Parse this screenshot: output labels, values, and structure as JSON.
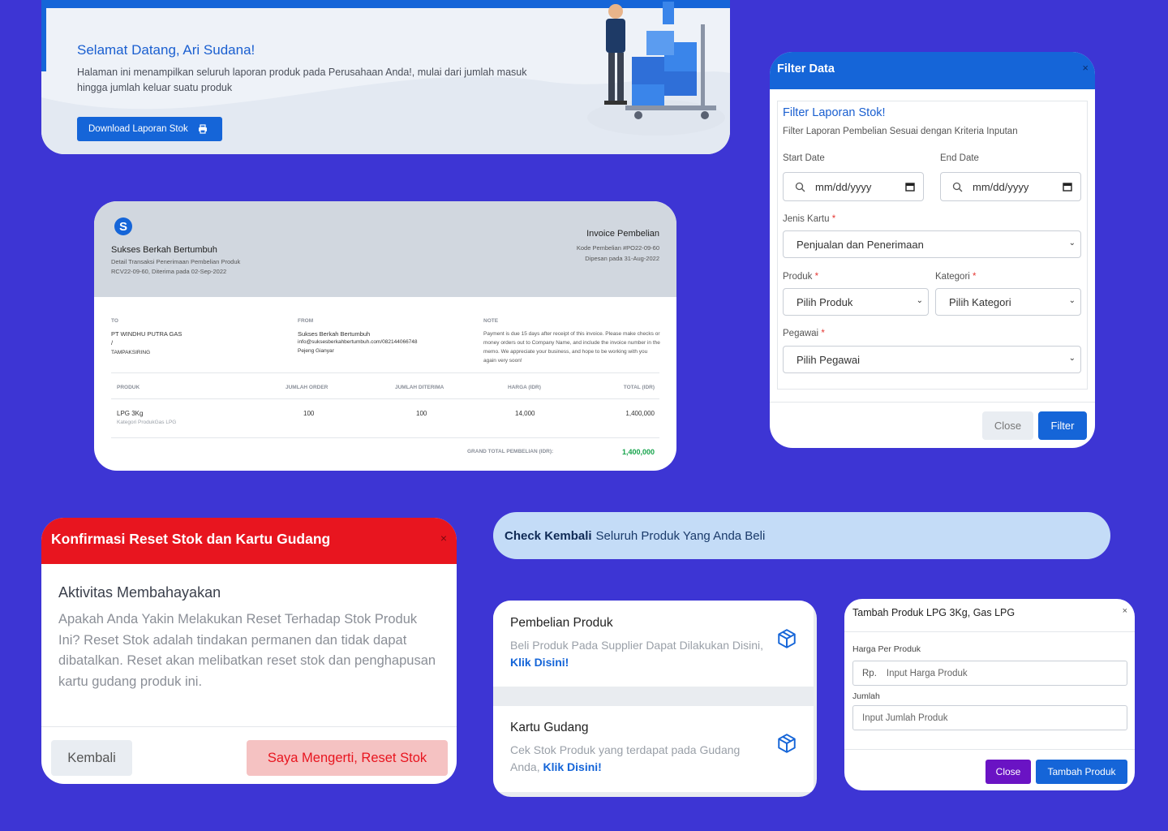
{
  "welcome": {
    "title": "Selamat Datang, Ari Sudana!",
    "desc": "Halaman ini menampilkan seluruh laporan produk pada Perusahaan Anda!, mulai dari jumlah masuk hingga jumlah keluar suatu produk",
    "button_label": "Download Laporan Stok",
    "button_icon": "printer-icon"
  },
  "invoice": {
    "logo_letter": "S",
    "company": "Sukses Berkah Bertumbuh",
    "detail_line": "Detail Transaksi Penerimaan Pembelian Produk",
    "rcv_line": "RCV22-09-60, Diterima pada 02-Sep-2022",
    "title": "Invoice Pembelian",
    "code_line": "Kode Pembelian #PO22-09-60",
    "ordered_line": "Dipesan pada 31-Aug-2022",
    "to_label": "TO",
    "to_name": "PT WINDHU PUTRA GAS",
    "to_sep": "/",
    "to_city": "TAMPAKSIRING",
    "from_label": "FROM",
    "from_name": "Sukses Berkah Bertumbuh",
    "from_contact": "info@suksesberkahbertumbuh.com/082144066748",
    "from_city": "Pejeng Gianyar",
    "note_label": "NOTE",
    "note_text": "Payment is due 15 days after receipt of this invoice. Please make checks or money orders out to Company Name, and include the invoice number in the memo. We appreciate your business, and hope to be working with you again very soon!",
    "columns": [
      "PRODUK",
      "JUMLAH ORDER",
      "JUMLAH DITERIMA",
      "HARGA (IDR)",
      "TOTAL (IDR)"
    ],
    "rows": [
      {
        "product": "LPG 3Kg",
        "category": "Kategori ProdukGas LPG",
        "order": "100",
        "received": "100",
        "price": "14,000",
        "total": "1,400,000"
      }
    ],
    "grand_total_label": "GRAND TOTAL PEMBELIAN (IDR):",
    "grand_total": "1,400,000"
  },
  "filter": {
    "header": "Filter Data",
    "close_glyph": "×",
    "title": "Filter Laporan Stok!",
    "subtitle": "Filter Laporan Pembelian Sesuai dengan Kriteria Inputan",
    "start_label": "Start Date",
    "end_label": "End Date",
    "date_placeholder": "mm/dd/yyyy",
    "jenis_label": "Jenis Kartu",
    "jenis_value": "Penjualan dan Penerimaan",
    "produk_label": "Produk",
    "produk_value": "Pilih Produk",
    "kategori_label": "Kategori",
    "kategori_value": "Pilih Kategori",
    "pegawai_label": "Pegawai",
    "pegawai_value": "Pilih Pegawai",
    "required_mark": "*",
    "close_label": "Close",
    "submit_label": "Filter"
  },
  "reset": {
    "header": "Konfirmasi Reset Stok dan Kartu Gudang",
    "close_glyph": "×",
    "title": "Aktivitas Membahayakan",
    "body": "Apakah Anda Yakin Melakukan Reset Terhadap Stok Produk Ini? Reset Stok adalah tindakan permanen dan tidak dapat dibatalkan. Reset akan melibatkan reset stok dan penghapusan kartu gudang produk ini.",
    "back_label": "Kembali",
    "confirm_label": "Saya Mengerti, Reset Stok"
  },
  "check": {
    "bold": "Check Kembali",
    "rest": "Seluruh Produk Yang Anda Beli"
  },
  "actions": [
    {
      "title": "Pembelian Produk",
      "desc": "Beli Produk Pada Supplier Dapat Dilakukan Disini, ",
      "link": "Klik Disini!",
      "icon": "box-icon"
    },
    {
      "title": "Kartu Gudang",
      "desc": "Cek Stok Produk yang terdapat pada Gudang Anda, ",
      "link": "Klik Disini!",
      "icon": "box-icon"
    }
  ],
  "tambah": {
    "title": "Tambah Produk LPG 3Kg, Gas LPG",
    "close_glyph": "×",
    "price_label": "Harga Per Produk",
    "price_prefix": "Rp.",
    "price_placeholder": "Input Harga Produk",
    "qty_label": "Jumlah",
    "qty_placeholder": "Input Jumlah Produk",
    "close_label": "Close",
    "submit_label": "Tambah Produk"
  },
  "colors": {
    "background": "#3d35d4",
    "primary": "#1565d8",
    "danger": "#e8151f",
    "success": "#14a34a",
    "purple": "#6a13c4"
  }
}
